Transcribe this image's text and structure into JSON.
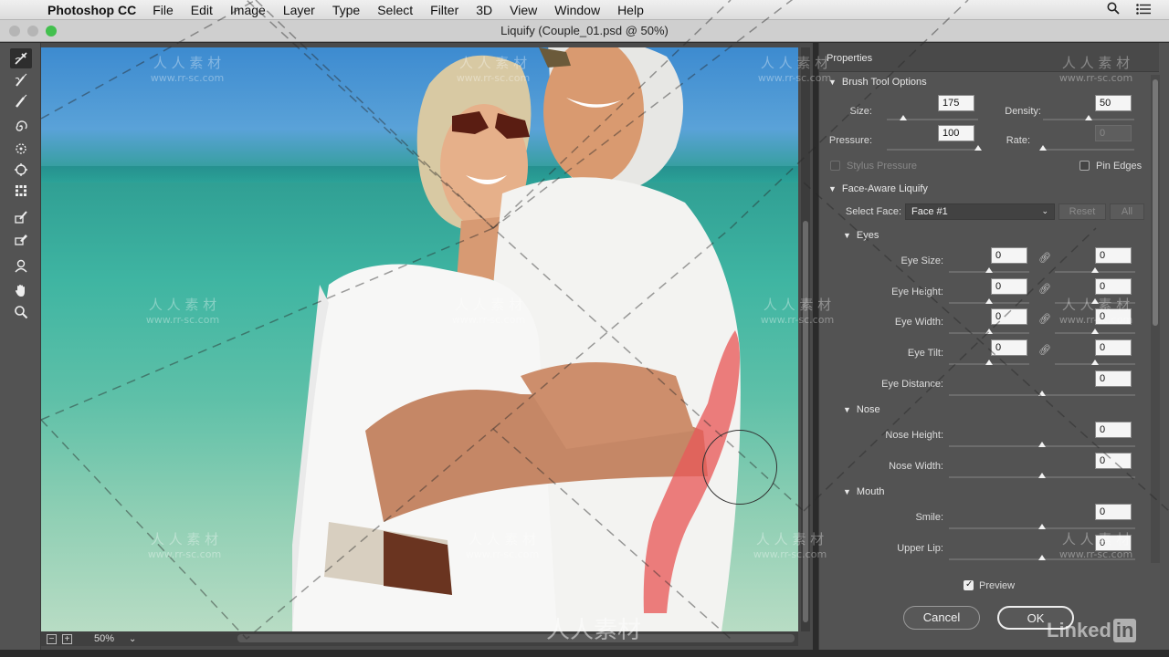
{
  "menubar": {
    "app_name": "Photoshop CC",
    "items": [
      "File",
      "Edit",
      "Image",
      "Layer",
      "Type",
      "Select",
      "Filter",
      "3D",
      "View",
      "Window",
      "Help"
    ]
  },
  "window": {
    "title": "Liquify (Couple_01.psd @ 50%)"
  },
  "status": {
    "zoom": "50%"
  },
  "panel": {
    "title": "Properties",
    "brush": {
      "section_label": "Brush Tool Options",
      "size_label": "Size:",
      "size_value": "175",
      "size_level": 0.18,
      "density_label": "Density:",
      "density_value": "50",
      "density_level": 0.5,
      "pressure_label": "Pressure:",
      "pressure_value": "100",
      "pressure_level": 1.0,
      "rate_label": "Rate:",
      "rate_value": "0",
      "rate_level": 0.0,
      "stylus_label": "Stylus Pressure",
      "pin_edges_label": "Pin Edges"
    },
    "face": {
      "section_label": "Face-Aware Liquify",
      "select_face_label": "Select Face:",
      "select_face_value": "Face #1",
      "reset_label": "Reset",
      "all_label": "All",
      "eyes": {
        "label": "Eyes",
        "rows": [
          {
            "label": "Eye Size:",
            "left": "0",
            "right": "0"
          },
          {
            "label": "Eye Height:",
            "left": "0",
            "right": "0"
          },
          {
            "label": "Eye Width:",
            "left": "0",
            "right": "0"
          },
          {
            "label": "Eye Tilt:",
            "left": "0",
            "right": "0"
          }
        ],
        "distance_label": "Eye Distance:",
        "distance_value": "0"
      },
      "nose": {
        "label": "Nose",
        "height_label": "Nose Height:",
        "height_value": "0",
        "width_label": "Nose Width:",
        "width_value": "0"
      },
      "mouth": {
        "label": "Mouth",
        "smile_label": "Smile:",
        "smile_value": "0",
        "upper_lip_label": "Upper Lip:",
        "upper_lip_value": "0"
      }
    },
    "preview_label": "Preview",
    "cancel_label": "Cancel",
    "ok_label": "OK"
  },
  "watermark": {
    "cn": "人 人 素 材",
    "url": "www.rr-sc.com",
    "center": "人人素材"
  },
  "linkedin": {
    "text": "Linked",
    "in": "in"
  }
}
